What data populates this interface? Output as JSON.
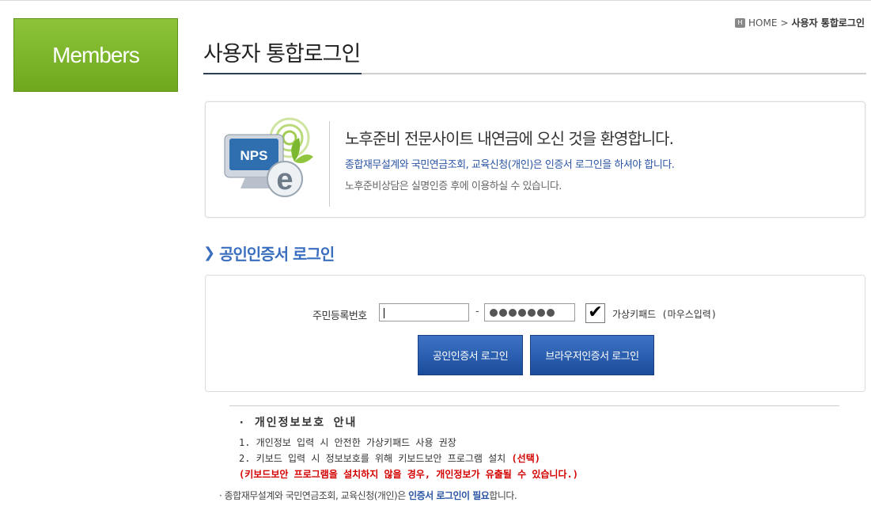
{
  "sidebar": {
    "members_label": "Members"
  },
  "breadcrumb": {
    "home_icon": "H",
    "home": "HOME",
    "sep": ">",
    "current": "사용자 통합로그인"
  },
  "page": {
    "title": "사용자 통합로그인"
  },
  "welcome": {
    "logo_text": "NPS",
    "headline": "노후준비 전문사이트 내연금에 오신 것을 환영합니다.",
    "blue_text": "종합재무설계와 국민연금조회, 교육신청(개인)은 인증서 로그인을 하셔야 합니다.",
    "gray_text": "노후준비상담은 실명인증 후에 이용하실 수 있습니다."
  },
  "cert_login": {
    "section_title": "공인인증서 로그인",
    "rrn_label": "주민등록번호",
    "rrn_front_value": "",
    "rrn_dash": "-",
    "rrn_back_masked_count": 7,
    "virtual_keypad_checked": true,
    "check_mark": "✔",
    "virtual_keypad_label": "가상키패드 (마우스입력)",
    "btn_cert": "공인인증서 로그인",
    "btn_browser": "브라우저인증서 로그인"
  },
  "notice": {
    "title": "· 개인정보보호 안내",
    "item1": "1. 개인정보 입력 시 안전한 가상키패드 사용 권장",
    "item2": "2. 키보드 입력 시 정보보호를 위해 키보드보안 프로그램 설치",
    "item2_highlight": "(선택)",
    "warning": "(키보드보안 프로그램을 설치하지 않을 경우, 개인정보가 유출될 수 있습니다.)",
    "footer_prefix": "· 종합재무설계와 국민연금조회, 교육신청(개인)은",
    "footer_emphasis": "인증서 로그인이 필요",
    "footer_suffix": "합니다."
  }
}
